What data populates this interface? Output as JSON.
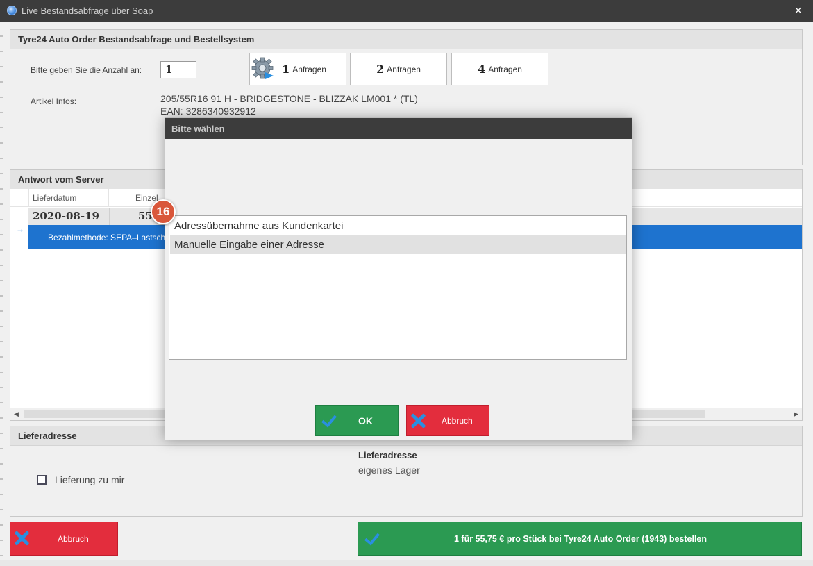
{
  "window": {
    "title": "Live Bestandsabfrage über Soap",
    "close_glyph": "×"
  },
  "order_panel": {
    "header": "Tyre24 Auto Order Bestandsabfrage und Bestellsystem",
    "qty_label": "Bitte geben Sie die Anzahl an:",
    "qty_value": "1",
    "request_buttons": [
      {
        "num": "1",
        "label": "Anfragen"
      },
      {
        "num": "2",
        "label": "Anfragen"
      },
      {
        "num": "4",
        "label": "Anfragen"
      }
    ],
    "article_label": "Artikel Infos:",
    "article_line1": "205/55R16 91 H - BRIDGESTONE - BLIZZAK LM001 * (TL)",
    "article_line2": "EAN: 3286340932912"
  },
  "server_panel": {
    "header": "Antwort vom Server",
    "columns": [
      "Lieferdatum",
      "Einzel"
    ],
    "row": {
      "date": "2020-08-19",
      "price": "55"
    },
    "detail": "Bezahlmethode: SEPA–Lastsch",
    "arrow": "→"
  },
  "delivery_panel": {
    "header": "Lieferadresse",
    "checkbox_label": "Lieferung zu mir",
    "address_heading": "Lieferadresse",
    "address_value": "eigenes Lager"
  },
  "footer": {
    "cancel_label": "Abbruch",
    "order_label": "1 für 55,75 € pro Stück bei Tyre24 Auto Order (1943) bestellen"
  },
  "dialog": {
    "title": "Bitte wählen",
    "options": [
      "Adressübernahme aus Kundenkartei",
      "Manuelle Eingabe einer Adresse"
    ],
    "selected_index": 1,
    "ok_label": "OK",
    "cancel_label": "Abbruch"
  },
  "step_badge": "16",
  "colors": {
    "accent_blue": "#1e73cf",
    "ok_green": "#2b9a52",
    "cancel_red": "#e32d3d",
    "badge": "#d9573b"
  }
}
